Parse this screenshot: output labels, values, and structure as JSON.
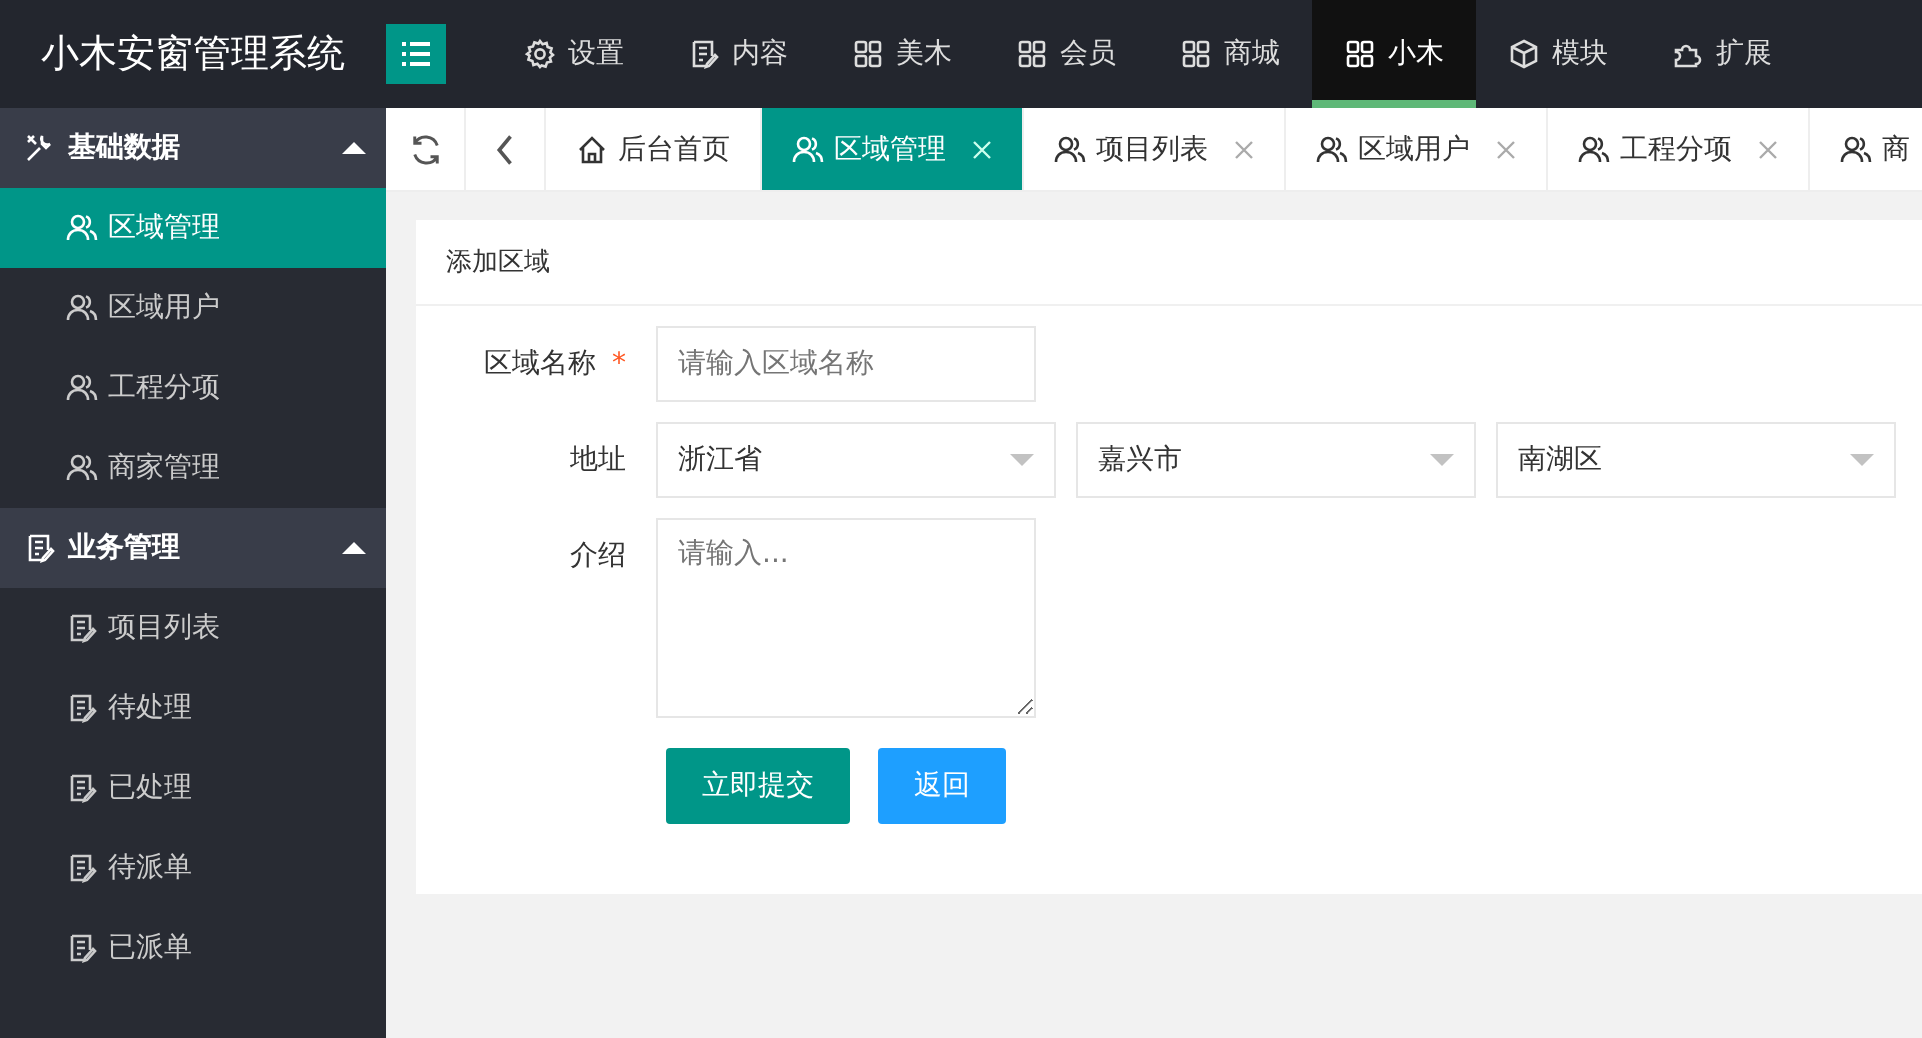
{
  "app_title": "小木安窗管理系统",
  "top_nav": [
    {
      "label": "设置",
      "selected": false
    },
    {
      "label": "内容",
      "selected": false
    },
    {
      "label": "美木",
      "selected": false
    },
    {
      "label": "会员",
      "selected": false
    },
    {
      "label": "商城",
      "selected": false
    },
    {
      "label": "小木",
      "selected": true
    },
    {
      "label": "模块",
      "selected": false
    },
    {
      "label": "扩展",
      "selected": false
    }
  ],
  "sidebar": [
    {
      "label": "基础数据",
      "expanded": true,
      "items": [
        {
          "label": "区域管理",
          "selected": true
        },
        {
          "label": "区域用户",
          "selected": false
        },
        {
          "label": "工程分项",
          "selected": false
        },
        {
          "label": "商家管理",
          "selected": false
        }
      ]
    },
    {
      "label": "业务管理",
      "expanded": true,
      "items": [
        {
          "label": "项目列表",
          "selected": false
        },
        {
          "label": "待处理",
          "selected": false
        },
        {
          "label": "已处理",
          "selected": false
        },
        {
          "label": "待派单",
          "selected": false
        },
        {
          "label": "已派单",
          "selected": false
        }
      ]
    }
  ],
  "tabs": [
    {
      "label": "后台首页",
      "selected": false,
      "closable": false
    },
    {
      "label": "区域管理",
      "selected": true,
      "closable": true
    },
    {
      "label": "项目列表",
      "selected": false,
      "closable": true
    },
    {
      "label": "区域用户",
      "selected": false,
      "closable": true
    },
    {
      "label": "工程分项",
      "selected": false,
      "closable": true
    },
    {
      "label": "商",
      "selected": false,
      "closable": false
    }
  ],
  "form": {
    "title": "添加区域",
    "name_field": {
      "label": "区域名称",
      "required_mark": "*",
      "placeholder": "请输入区域名称"
    },
    "address": {
      "label": "地址",
      "selects": [
        "浙江省",
        "嘉兴市",
        "南湖区"
      ]
    },
    "intro": {
      "label": "介绍",
      "placeholder": "请输入..."
    },
    "buttons": [
      "立即提交",
      "返回"
    ]
  }
}
